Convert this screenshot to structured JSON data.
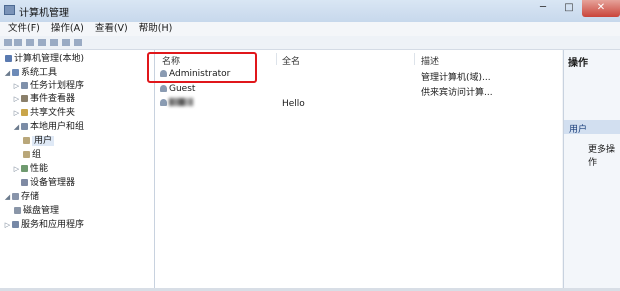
{
  "window": {
    "title": "计算机管理"
  },
  "menubar": {
    "items": [
      "文件(F)",
      "操作(A)",
      "查看(V)",
      "帮助(H)"
    ]
  },
  "tree": {
    "items": [
      {
        "label": "计算机管理(本地)",
        "twisty": "",
        "color": "#5a7ab0"
      },
      {
        "label": "系统工具",
        "twisty": "◢",
        "color": "#6d8bb8"
      },
      {
        "label": "任务计划程序",
        "twisty": "▷",
        "color": "#7f90aa"
      },
      {
        "label": "事件查看器",
        "twisty": "▷",
        "color": "#8a7f6a"
      },
      {
        "label": "共享文件夹",
        "twisty": "▷",
        "color": "#c9a54a"
      },
      {
        "label": "本地用户和组",
        "twisty": "◢",
        "color": "#7b8ca6"
      },
      {
        "label": "用户",
        "twisty": "",
        "color": "#b9a77a"
      },
      {
        "label": "组",
        "twisty": "",
        "color": "#b9a77a"
      },
      {
        "label": "性能",
        "twisty": "▷",
        "color": "#6f9a6f"
      },
      {
        "label": "设备管理器",
        "twisty": "",
        "color": "#7f8aa3"
      },
      {
        "label": "存储",
        "twisty": "◢",
        "color": "#8894aa"
      },
      {
        "label": "磁盘管理",
        "twisty": "",
        "color": "#8a96a8"
      },
      {
        "label": "服务和应用程序",
        "twisty": "▷",
        "color": "#7688a6"
      }
    ]
  },
  "main": {
    "columns": [
      "名称",
      "全名",
      "描述"
    ],
    "rows": [
      {
        "name": "Administrator",
        "fullname": "",
        "description": "管理计算机(域)..."
      },
      {
        "name": "Guest",
        "fullname": "",
        "description": "供来宾访问计算..."
      },
      {
        "name": "",
        "fullname": "Hello",
        "description": ""
      }
    ]
  },
  "actions": {
    "header": "操作",
    "section": "用户",
    "more": "更多操作"
  }
}
